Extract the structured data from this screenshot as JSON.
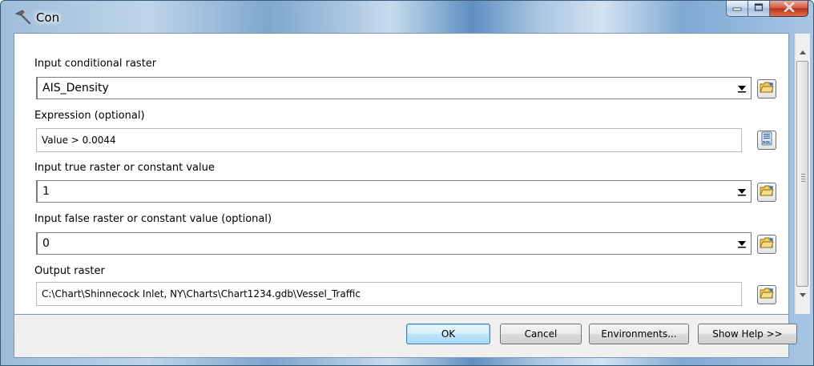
{
  "window": {
    "title": "Con",
    "title_icon": "hammer-icon",
    "controls": {
      "minimize_icon": "minimize-icon",
      "maximize_icon": "maximize-icon",
      "close_icon": "close-icon"
    }
  },
  "form": {
    "fields": [
      {
        "label": "Input conditional raster",
        "value": "AIS_Density",
        "kind": "combo",
        "button_icon": "browse-folder-icon"
      },
      {
        "label": "Expression (optional)",
        "value": "Value > 0.0044",
        "kind": "text",
        "button_icon": "sql-icon",
        "button_text": "SQL"
      },
      {
        "label": "Input true raster or constant value",
        "value": "1",
        "kind": "combo",
        "button_icon": "browse-folder-icon"
      },
      {
        "label": "Input false raster or constant value (optional)",
        "value": "0",
        "kind": "combo",
        "button_icon": "browse-folder-icon"
      },
      {
        "label": "Output raster",
        "value": "C:\\Chart\\Shinnecock Inlet, NY\\Charts\\Chart1234.gdb\\Vessel_Traffic",
        "kind": "text",
        "button_icon": "browse-folder-icon"
      }
    ]
  },
  "footer": {
    "ok_label": "OK",
    "cancel_label": "Cancel",
    "environments_label": "Environments...",
    "help_label": "Show Help >>"
  },
  "colors": {
    "accent": "#3c7fb1",
    "close_button": "#c0392b",
    "folder_icon": "#e8b93a"
  }
}
